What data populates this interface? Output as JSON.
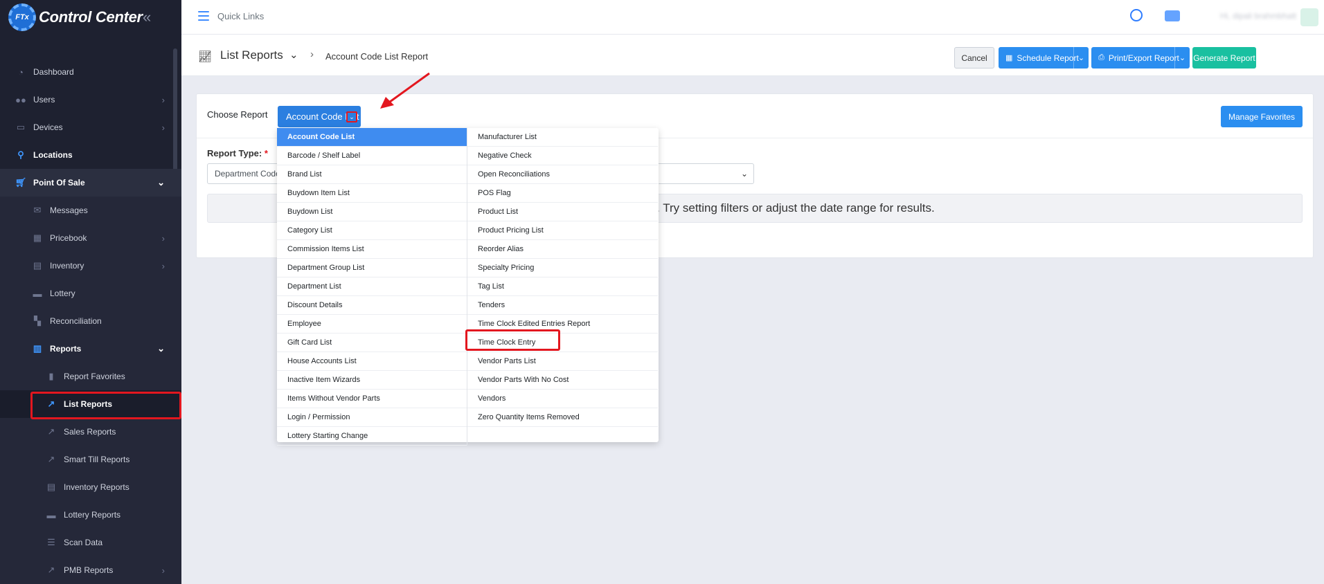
{
  "app": {
    "title": "Control Center",
    "logo_badge": "FTx"
  },
  "topbar": {
    "quick_links": "Quick Links",
    "user_name": "Hi, dipali brahmbhatt"
  },
  "sidebar": {
    "items": [
      {
        "label": "Dashboard",
        "icon": "dashboard-icon"
      },
      {
        "label": "Users",
        "icon": "users-icon"
      },
      {
        "label": "Devices",
        "icon": "devices-icon"
      },
      {
        "label": "Locations",
        "icon": "location-pin-icon"
      },
      {
        "label": "Point Of Sale",
        "icon": "cart-icon"
      },
      {
        "label": "Messages",
        "icon": "messages-icon"
      },
      {
        "label": "Pricebook",
        "icon": "pricebook-icon"
      },
      {
        "label": "Inventory",
        "icon": "inventory-icon"
      },
      {
        "label": "Lottery",
        "icon": "lottery-icon"
      },
      {
        "label": "Reconciliation",
        "icon": "reconciliation-icon"
      },
      {
        "label": "Reports",
        "icon": "reports-icon"
      },
      {
        "label": "Report Favorites",
        "icon": "bookmark-icon"
      },
      {
        "label": "List Reports",
        "icon": "line-chart-icon"
      },
      {
        "label": "Sales Reports",
        "icon": "line-chart-icon"
      },
      {
        "label": "Smart Till Reports",
        "icon": "line-chart-icon"
      },
      {
        "label": "Inventory Reports",
        "icon": "inventory-icon"
      },
      {
        "label": "Lottery Reports",
        "icon": "lottery-icon"
      },
      {
        "label": "Scan Data",
        "icon": "list-icon"
      },
      {
        "label": "PMB Reports",
        "icon": "line-chart-icon"
      }
    ]
  },
  "header": {
    "breadcrumb_title": "List Reports",
    "breadcrumb_current": "Account Code List Report",
    "cancel_label": "Cancel",
    "schedule_label": "Schedule Report",
    "print_label": "Print/Export Report",
    "generate_label": "Generate Report"
  },
  "card": {
    "choose_label": "Choose Report",
    "selected_report": "Account Code List",
    "manage_favorites": "Manage Favorites",
    "report_type_label": "Report Type:",
    "report_type_value": "Department Code",
    "empty_message": "Report is empty. Try setting filters or adjust the date range for results."
  },
  "dropdown": {
    "left": [
      "Account Code List",
      "Barcode / Shelf Label",
      "Brand List",
      "Buydown Item List",
      "Buydown List",
      "Category List",
      "Commission Items List",
      "Department Group List",
      "Department List",
      "Discount Details",
      "Employee",
      "Gift Card List",
      "House Accounts List",
      "Inactive Item Wizards",
      "Items Without Vendor Parts",
      "Login / Permission",
      "Lottery Starting Change"
    ],
    "right": [
      "Manufacturer List",
      "Negative Check",
      "Open Reconciliations",
      "POS Flag",
      "Product List",
      "Product Pricing List",
      "Reorder Alias",
      "Specialty Pricing",
      "Tag List",
      "Tenders",
      "Time Clock Edited Entries Report",
      "Time Clock Entry",
      "Vendor Parts List",
      "Vendor Parts With No Cost",
      "Vendors",
      "Zero Quantity Items Removed"
    ]
  },
  "colors": {
    "accent": "#2b8ef0",
    "highlight": "#e3171f",
    "success": "#19c0a0",
    "sidebar": "#1e2130"
  }
}
